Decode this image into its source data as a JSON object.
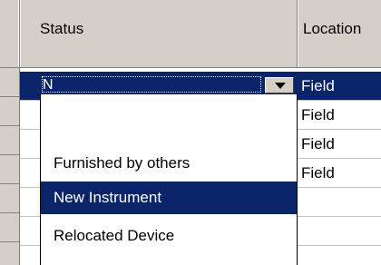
{
  "grid": {
    "columns": [
      {
        "label": "Status"
      },
      {
        "label": "Location"
      }
    ],
    "rows": [
      {
        "status": "N",
        "location": "Field",
        "selected": true
      },
      {
        "status": "",
        "location": "Field"
      },
      {
        "status": "",
        "location": "Field"
      },
      {
        "status": "",
        "location": "Field"
      },
      {
        "status": "",
        "location": ""
      },
      {
        "status": "",
        "location": ""
      }
    ]
  },
  "editor": {
    "value": "N",
    "dropdown_button": "chevron-down-icon"
  },
  "dropdown": {
    "options": [
      {
        "label": ""
      },
      {
        "label": "Furnished by others"
      },
      {
        "label": "New Instrument",
        "highlighted": true
      },
      {
        "label": "Relocated Device"
      }
    ]
  },
  "colors": {
    "selection": "#0a246a",
    "header_bg": "#d4d0c8",
    "grid_line": "#c0c0c0"
  }
}
